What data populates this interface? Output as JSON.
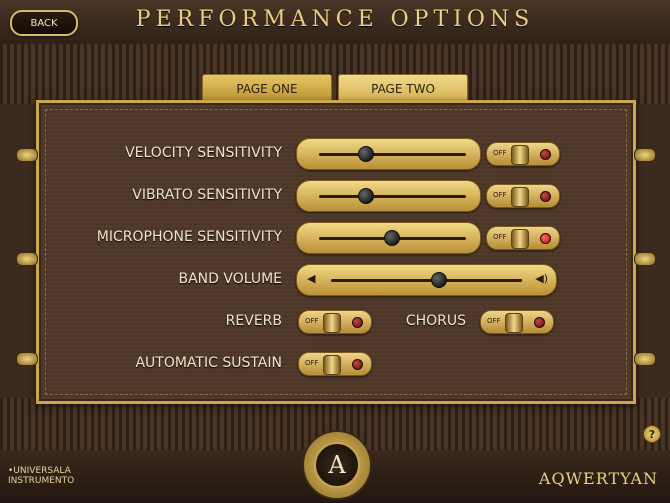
{
  "header": {
    "back_label": "BACK",
    "title": "PERFORMANCE OPTIONS"
  },
  "tabs": [
    {
      "label": "PAGE ONE",
      "active": false
    },
    {
      "label": "PAGE TWO",
      "active": true
    }
  ],
  "settings": {
    "velocity": {
      "label": "VELOCITY SENSITIVITY",
      "level": 0.31,
      "off_label": "OFF",
      "enabled": false
    },
    "vibrato": {
      "label": "VIBRATO SENSITIVITY",
      "level": 0.31,
      "off_label": "OFF",
      "enabled": false
    },
    "microphone": {
      "label": "MICROPHONE SENSITIVITY",
      "level": 0.49,
      "off_label": "OFF",
      "enabled": true
    },
    "band_volume": {
      "label": "BAND VOLUME",
      "level": 0.56
    },
    "reverb": {
      "label": "REVERB",
      "off_label": "OFF",
      "enabled": false
    },
    "chorus": {
      "label": "CHORUS",
      "off_label": "OFF",
      "enabled": false
    },
    "sustain": {
      "label": "AUTOMATIC SUSTAIN",
      "off_label": "OFF",
      "enabled": false
    }
  },
  "footer": {
    "brand_left_line1": "•UNIVERSALA",
    "brand_left_line2": "INSTRUMENTO",
    "brand_right": "AQWERTYAN",
    "logo_letter": "A",
    "help_label": "?"
  },
  "colors": {
    "gold": "#e9cf84",
    "panel": "#4c3628",
    "led_on": "#ff4a3a"
  },
  "icons": [
    "speaker-low-icon",
    "speaker-high-icon",
    "help-icon",
    "logo-icon"
  ]
}
